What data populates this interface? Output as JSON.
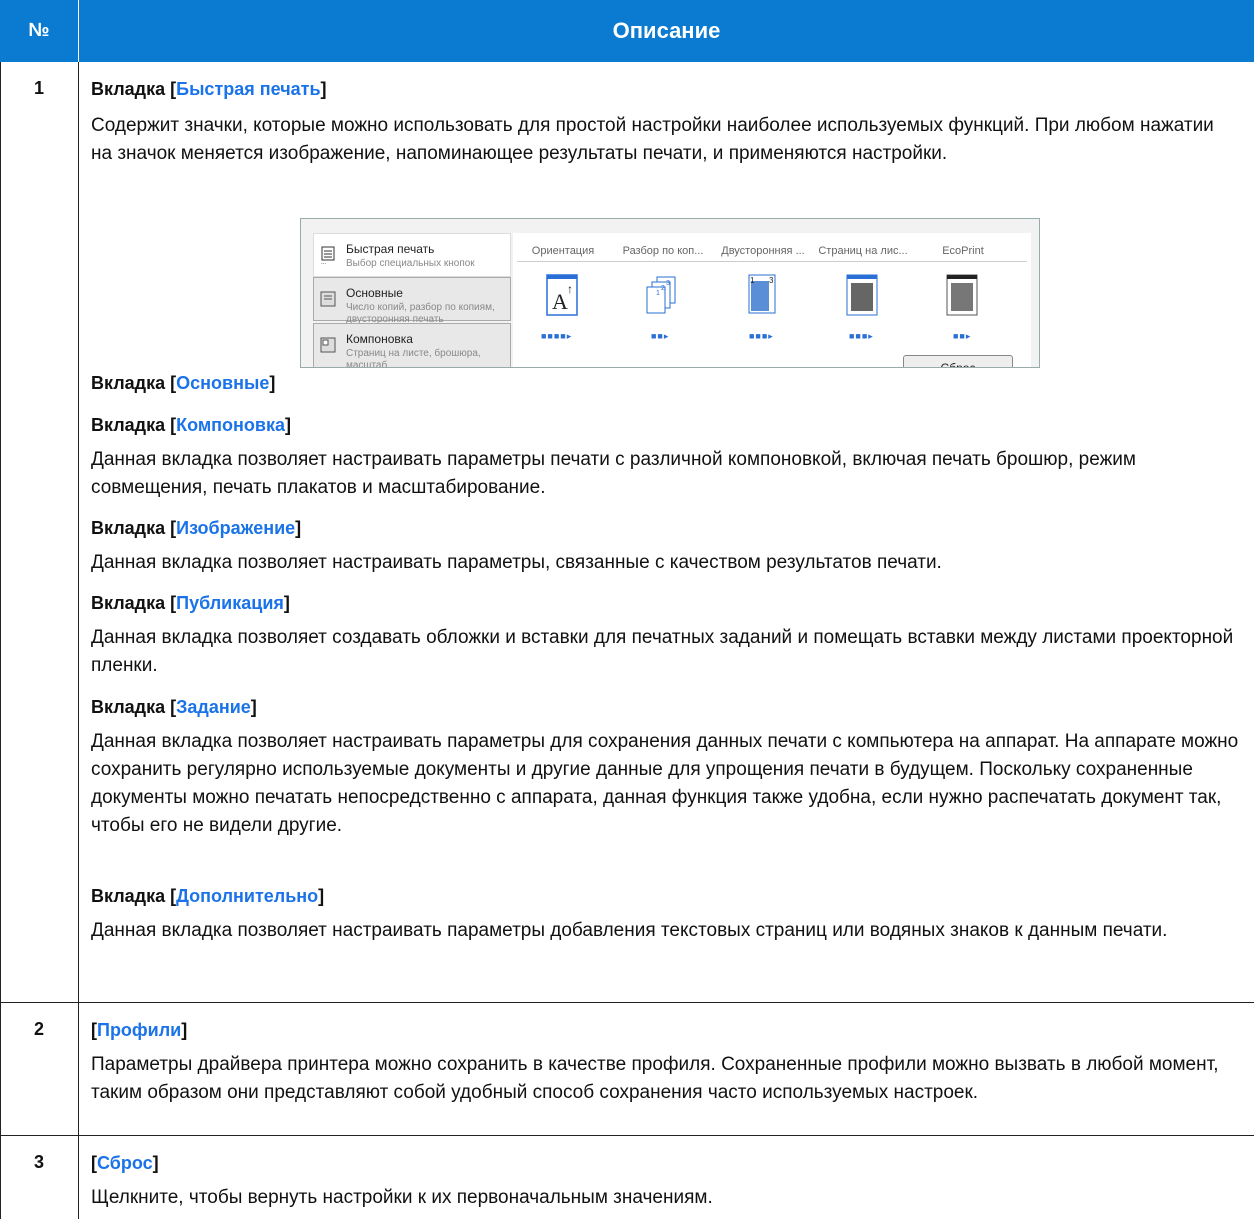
{
  "header": {
    "col_no": "№",
    "col_desc": "Описание"
  },
  "row1": {
    "number": "1",
    "quick": {
      "prefix": "Вкладка [",
      "link": "Быстрая печать",
      "suffix": "]",
      "text": "Содержит значки, которые можно использовать для простой настройки наиболее используемых функций. При любом нажатии на значок меняется изображение, напоминающее результаты печати, и применяются настройки."
    },
    "screenshot": {
      "tabs": [
        {
          "title": "Быстрая печать",
          "subtitle": "Выбор специальных кнопок"
        },
        {
          "title": "Основные",
          "subtitle": "Число копий, разбор по копиям, двусторонняя печать"
        },
        {
          "title": "Компоновка",
          "subtitle": "Страниц на листе, брошюра, масштаб"
        }
      ],
      "columns": [
        "Ориентация",
        "Разбор по коп...",
        "Двусторонняя ...",
        "Страниц на лис...",
        "EcoPrint"
      ],
      "reset_button": "Сброс"
    },
    "basic": {
      "prefix": "Вкладка [",
      "link": "Основные",
      "suffix": "]"
    },
    "layout": {
      "prefix": "Вкладка [",
      "link": "Компоновка",
      "suffix": "]",
      "text": "Данная вкладка позволяет настраивать параметры печати с различной компоновкой, включая печать брошюр, режим совмещения, печать плакатов и масштабирование."
    },
    "image": {
      "prefix": "Вкладка [",
      "link": "Изображение",
      "suffix": "]",
      "text": "Данная вкладка позволяет настраивать параметры, связанные с качеством результатов печати."
    },
    "publish": {
      "prefix": "Вкладка [",
      "link": "Публикация",
      "suffix": "]",
      "text": "Данная вкладка позволяет создавать обложки и вставки для печатных заданий и помещать вставки между листами проекторной пленки."
    },
    "job": {
      "prefix": "Вкладка [",
      "link": "Задание",
      "suffix": "]",
      "text": "Данная вкладка позволяет настраивать параметры для сохранения данных печати с компьютера на аппарат. На аппарате можно сохранить регулярно используемые документы и другие данные для упрощения печати в будущем. Поскольку сохраненные документы можно печатать непосредственно с аппарата, данная функция также удобна, если нужно распечатать документ так, чтобы его не видели другие."
    },
    "advanced": {
      "prefix": "Вкладка [",
      "link": "Дополнительно",
      "suffix": "]",
      "text": "Данная вкладка позволяет настраивать параметры добавления текстовых страниц или водяных знаков к данным печати."
    }
  },
  "row2": {
    "number": "2",
    "prefix": "[",
    "link": "Профили",
    "suffix": "]",
    "text": "Параметры драйвера принтера можно сохранить в качестве профиля. Сохраненные профили можно вызвать в любой момент, таким образом они представляют собой удобный способ сохранения часто используемых настроек."
  },
  "row3": {
    "number": "3",
    "prefix": "[",
    "link": "Сброс",
    "suffix": "]",
    "text": "Щелкните, чтобы вернуть настройки к их первоначальным значениям."
  }
}
